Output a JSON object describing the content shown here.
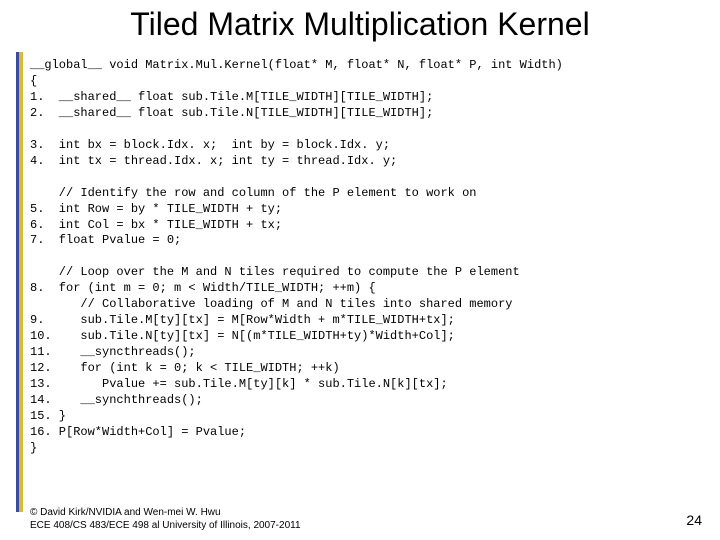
{
  "title": "Tiled Matrix Multiplication Kernel",
  "code": "__global__ void Matrix.Mul.Kernel(float* M, float* N, float* P, int Width)\n{\n1.  __shared__ float sub.Tile.M[TILE_WIDTH][TILE_WIDTH];\n2.  __shared__ float sub.Tile.N[TILE_WIDTH][TILE_WIDTH];\n\n3.  int bx = block.Idx. x;  int by = block.Idx. y;\n4.  int tx = thread.Idx. x; int ty = thread.Idx. y;\n\n    // Identify the row and column of the P element to work on\n5.  int Row = by * TILE_WIDTH + ty;\n6.  int Col = bx * TILE_WIDTH + tx;\n7.  float Pvalue = 0;\n\n    // Loop over the M and N tiles required to compute the P element\n8.  for (int m = 0; m < Width/TILE_WIDTH; ++m) {\n       // Collaborative loading of M and N tiles into shared memory\n9.     sub.Tile.M[ty][tx] = M[Row*Width + m*TILE_WIDTH+tx];\n10.    sub.Tile.N[ty][tx] = N[(m*TILE_WIDTH+ty)*Width+Col];\n11.    __syncthreads();\n12.    for (int k = 0; k < TILE_WIDTH; ++k)\n13.       Pvalue += sub.Tile.M[ty][k] * sub.Tile.N[k][tx];\n14.    __synchthreads();\n15. }\n16. P[Row*Width+Col] = Pvalue;\n}",
  "footer_line1": "© David Kirk/NVIDIA and Wen-mei W. Hwu",
  "footer_line2": "ECE 408/CS 483/ECE 498 al University of Illinois, 2007-2011",
  "page_number": "24"
}
